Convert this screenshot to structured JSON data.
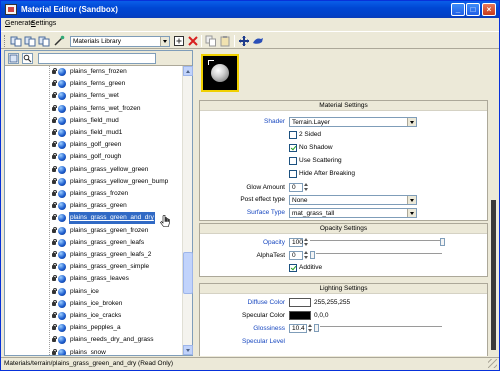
{
  "window": {
    "title": "Material Editor (Sandbox)"
  },
  "menu": {
    "generate": {
      "first": "G",
      "rest": "enerate"
    },
    "settings": {
      "first": "S",
      "rest": "ettings"
    }
  },
  "toolbar": {
    "library_combo": "Materials Library"
  },
  "tree": {
    "items": [
      "plains_ferns_frozen",
      "plains_ferns_green",
      "plains_ferns_wet",
      "plains_ferns_wet_frozen",
      "plains_field_mud",
      "plains_field_mud1",
      "plains_golf_green",
      "plains_golf_rough",
      "plains_grass_yellow_green",
      "plains_grass_yellow_green_bump",
      "plains_grass_frozen",
      "plains_grass_green",
      "plains_grass_green_and_dry",
      "plains_grass_green_frozen",
      "plains_grass_green_leafs",
      "plains_grass_green_leafs_2",
      "plains_grass_green_simple",
      "plains_grass_leaves",
      "plains_ice",
      "plains_ice_broken",
      "plains_ice_cracks",
      "plains_pepples_a",
      "plains_reeds_dry_and_grass",
      "plains_snow"
    ],
    "selected_index": 12,
    "folder_item": "railroad gravel",
    "folder_expander": "+"
  },
  "material_settings": {
    "header": "Material Settings",
    "shader_label": "Shader",
    "shader_value": "Terrain.Layer",
    "checkboxes": [
      {
        "label": "2 Sided",
        "checked": false
      },
      {
        "label": "No Shadow",
        "checked": true
      },
      {
        "label": "Use Scattering",
        "checked": false
      },
      {
        "label": "Hide After Breaking",
        "checked": false
      }
    ],
    "glow_label": "Glow Amount",
    "glow_value": "0",
    "post_effect_label": "Post effect type",
    "post_effect_value": "None",
    "surface_type_label": "Surface Type",
    "surface_type_value": "mat_grass_tall"
  },
  "opacity_settings": {
    "header": "Opacity Settings",
    "opacity_label": "Opacity",
    "opacity_value": "100",
    "alphatest_label": "AlphaTest",
    "alphatest_value": "0",
    "additive_label": "Additive",
    "additive_checked": true
  },
  "lighting_settings": {
    "header": "Lighting Settings",
    "diffuse_label": "Diffuse Color",
    "diffuse_value": "255,255,255",
    "diffuse_color": "#ffffff",
    "specular_label": "Specular Color",
    "specular_value": "0,0,0",
    "specular_color": "#000000",
    "glossiness_label": "Glossiness",
    "glossiness_value": "10.4",
    "specular_level_label": "Specular Level"
  },
  "statusbar": {
    "text": "Materials/terrain/plains_grass_green_and_dry (Read Only)"
  },
  "colors": {
    "title_blue": "#0047d4",
    "selection": "#316ac5",
    "link_blue": "#1848c0"
  }
}
